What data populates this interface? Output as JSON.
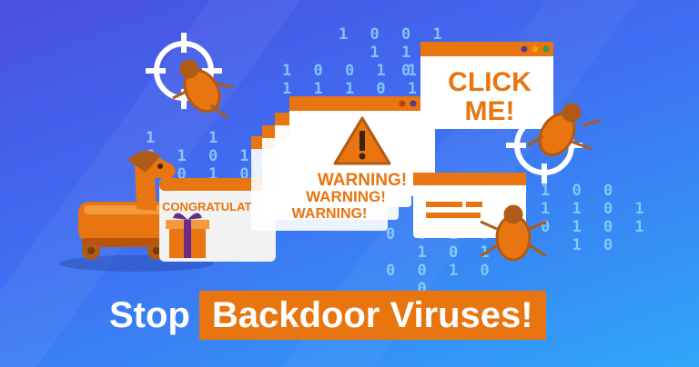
{
  "headline": {
    "prefix": "Stop",
    "highlight": "Backdoor Viruses!"
  },
  "popups": {
    "click_me": [
      "CLICK",
      "ME!"
    ],
    "warning": "WARNING!",
    "congrats": "CONGRATULAT"
  },
  "binary_columns": [
    "1 0 0 1\n  1 1 0\n    0 1",
    "1 0 0 1 1 0 1 1\n1 1 1 0 1 0 0",
    "1   1\n0 1 0 1\n1 0 1 0\n1 1 0",
    "0 0 1 0\n  1 0 1\n0 0 1 0\n  0",
    "1 0 0\n1 1 0 1\n0 1 0 1\n  1 0"
  ],
  "colors": {
    "orange": "#e8750f",
    "dark_orange": "#b9540a",
    "brown": "#b05a17",
    "white": "#ffffff",
    "light_blue": "#8fd3ff",
    "bg_top": "#4a4fe0",
    "bg_bottom": "#2fa6f7"
  },
  "icons": [
    "crosshair-icon",
    "bug-icon",
    "trojan-horse-icon",
    "gift-icon",
    "warning-triangle-icon"
  ]
}
